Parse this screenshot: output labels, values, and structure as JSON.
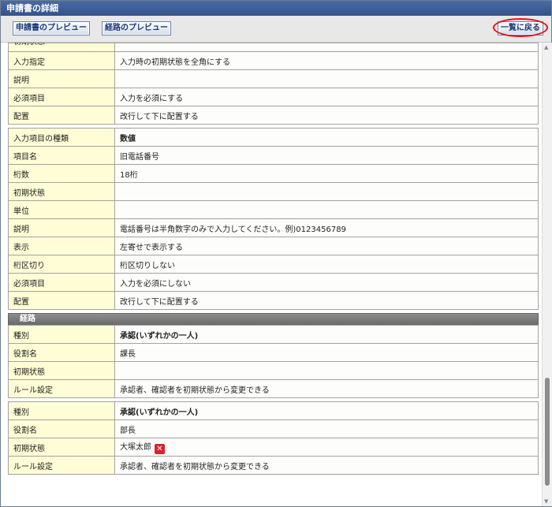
{
  "window": {
    "title": "申請書の詳細"
  },
  "toolbar": {
    "preview_form": "申請書のプレビュー",
    "preview_route": "経路のプレビュー",
    "back_to_list": "一覧に戻る"
  },
  "table_a": {
    "partial_label": "初期状態",
    "rows": [
      {
        "label": "入力指定",
        "value": "入力時の初期状態を全角にする"
      },
      {
        "label": "説明",
        "value": ""
      },
      {
        "label": "必須項目",
        "value": "入力を必須にする"
      },
      {
        "label": "配置",
        "value": "改行して下に配置する"
      }
    ]
  },
  "table_b": {
    "rows": [
      {
        "label": "入力項目の種類",
        "value": "数値"
      },
      {
        "label": "項目名",
        "value": "旧電話番号"
      },
      {
        "label": "桁数",
        "value": "18桁"
      },
      {
        "label": "初期状態",
        "value": ""
      },
      {
        "label": "単位",
        "value": ""
      },
      {
        "label": "説明",
        "value": "電話番号は半角数字のみで入力してください。例)0123456789"
      },
      {
        "label": "表示",
        "value": "左寄せで表示する"
      },
      {
        "label": "桁区切り",
        "value": "桁区切りしない"
      },
      {
        "label": "必須項目",
        "value": "入力を必須にしない"
      },
      {
        "label": "配置",
        "value": "改行して下に配置する"
      }
    ]
  },
  "route_section": {
    "title": "経路",
    "step1": {
      "rows": [
        {
          "label": "種別",
          "value": "承認(いずれかの一人)"
        },
        {
          "label": "役割名",
          "value": "課長"
        },
        {
          "label": "初期状態",
          "value": ""
        },
        {
          "label": "ルール設定",
          "value": "承認者、確認者を初期状態から変更できる"
        }
      ]
    },
    "step2": {
      "rows": [
        {
          "label": "種別",
          "value": "承認(いずれかの一人)"
        },
        {
          "label": "役割名",
          "value": "部長"
        },
        {
          "label": "初期状態",
          "value": "大塚太郎"
        },
        {
          "label": "ルール設定",
          "value": "承認者、確認者を初期状態から変更できる"
        }
      ],
      "remove_icon": "close-icon",
      "remove_symbol": "✕"
    }
  },
  "colors": {
    "title_bar": "#3a5a94",
    "label_cell": "#fefdd5",
    "section_bar": "#777777",
    "highlight": "#e0141c",
    "remove_icon": "#d8232a"
  }
}
